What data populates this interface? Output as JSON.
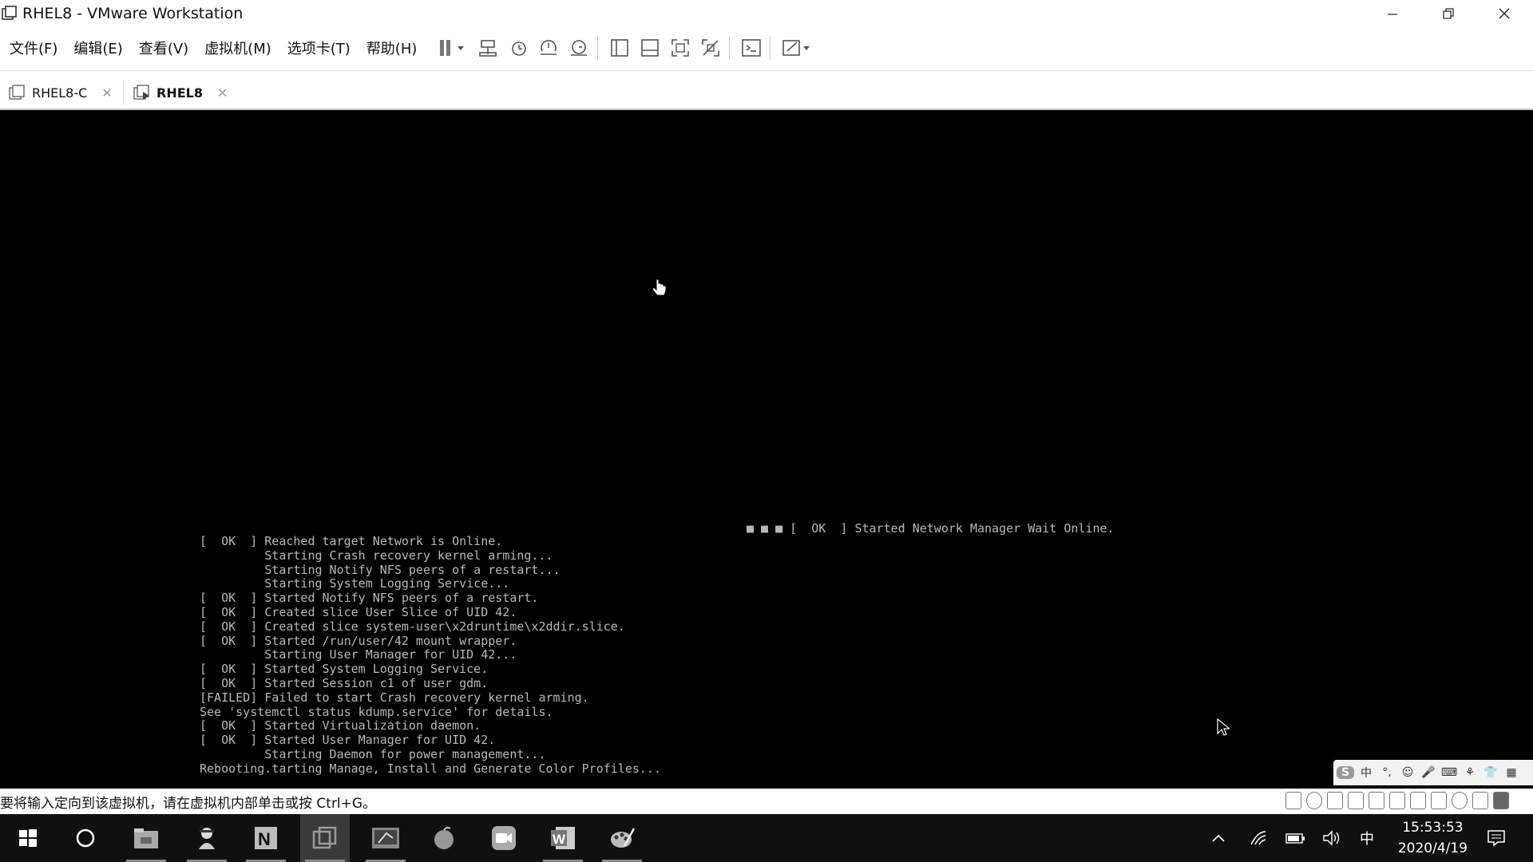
{
  "window": {
    "title": "RHEL8 - VMware Workstation"
  },
  "menu": {
    "items": [
      "文件(F)",
      "编辑(E)",
      "查看(V)",
      "虚拟机(M)",
      "选项卡(T)",
      "帮助(H)"
    ]
  },
  "tabs": [
    {
      "label": "RHEL8-C",
      "active": false
    },
    {
      "label": "RHEL8",
      "active": true
    }
  ],
  "console": {
    "stray_line": "■ ■ ■ [  OK  ] Started Network Manager Wait Online.",
    "lines": [
      "[  OK  ] Reached target Network is Online.",
      "         Starting Crash recovery kernel arming...",
      "         Starting Notify NFS peers of a restart...",
      "         Starting System Logging Service...",
      "[  OK  ] Started Notify NFS peers of a restart.",
      "[  OK  ] Created slice User Slice of UID 42.",
      "[  OK  ] Created slice system-user\\x2druntime\\x2ddir.slice.",
      "[  OK  ] Started /run/user/42 mount wrapper.",
      "         Starting User Manager for UID 42...",
      "[  OK  ] Started System Logging Service.",
      "[  OK  ] Started Session c1 of user gdm.",
      "[FAILED] Failed to start Crash recovery kernel arming.",
      "See 'systemctl status kdump.service' for details.",
      "[  OK  ] Started Virtualization daemon.",
      "[  OK  ] Started User Manager for UID 42.",
      "         Starting Daemon for power management...",
      "Rebooting.tarting Manage, Install and Generate Color Profiles..."
    ]
  },
  "ime": {
    "items": [
      "S",
      "中",
      "°,",
      "☺",
      "🎤",
      "⌨",
      "⚘",
      "👕",
      "▦"
    ]
  },
  "status": {
    "message": "要将输入定向到该虚拟机，请在虚拟机内部单击或按 Ctrl+G。"
  },
  "taskbar": {
    "time": "15:53:53",
    "date": "2020/4/19",
    "ime_lang": "中",
    "icons": [
      "start-icon",
      "cortana-icon",
      "file-manager-icon",
      "agent-icon",
      "onenote-icon",
      "vmware-icon",
      "terminal-icon",
      "fruit-icon",
      "zoom-icon",
      "word-icon",
      "paint-icon"
    ]
  }
}
